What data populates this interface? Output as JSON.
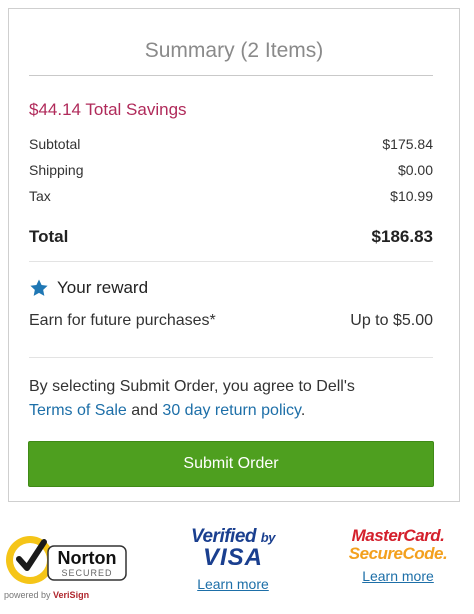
{
  "summary": {
    "title": "Summary (2 Items)",
    "savings": "$44.14 Total Savings",
    "rows": {
      "subtotal": {
        "label": "Subtotal",
        "value": "$175.84"
      },
      "shipping": {
        "label": "Shipping",
        "value": "$0.00"
      },
      "tax": {
        "label": "Tax",
        "value": "$10.99"
      },
      "total": {
        "label": "Total",
        "value": "$186.83"
      }
    },
    "reward": {
      "title": "Your reward",
      "earn_label": "Earn for future purchases*",
      "earn_value": "Up to $5.00",
      "icon": "star-icon"
    },
    "agreement": {
      "prefix": "By selecting Submit Order, you agree to Dell's",
      "terms_link": "Terms of Sale",
      "and": "and",
      "policy_link": "30 day return policy",
      "suffix": "."
    },
    "submit_label": "Submit Order"
  },
  "badges": {
    "norton": {
      "name": "Norton",
      "secured": "SECURED",
      "powered_prefix": "powered by",
      "powered_brand": "VeriSign"
    },
    "visa": {
      "line1": "Verified",
      "by": "by",
      "line2": "VISA",
      "learn": "Learn more"
    },
    "mastercard": {
      "line1": "MasterCard.",
      "line2": "SecureCode.",
      "learn": "Learn more"
    }
  },
  "colors": {
    "savings": "#b02a5a",
    "link": "#1d6fa8",
    "submit": "#4e9f1f",
    "star": "#1f77b4"
  }
}
